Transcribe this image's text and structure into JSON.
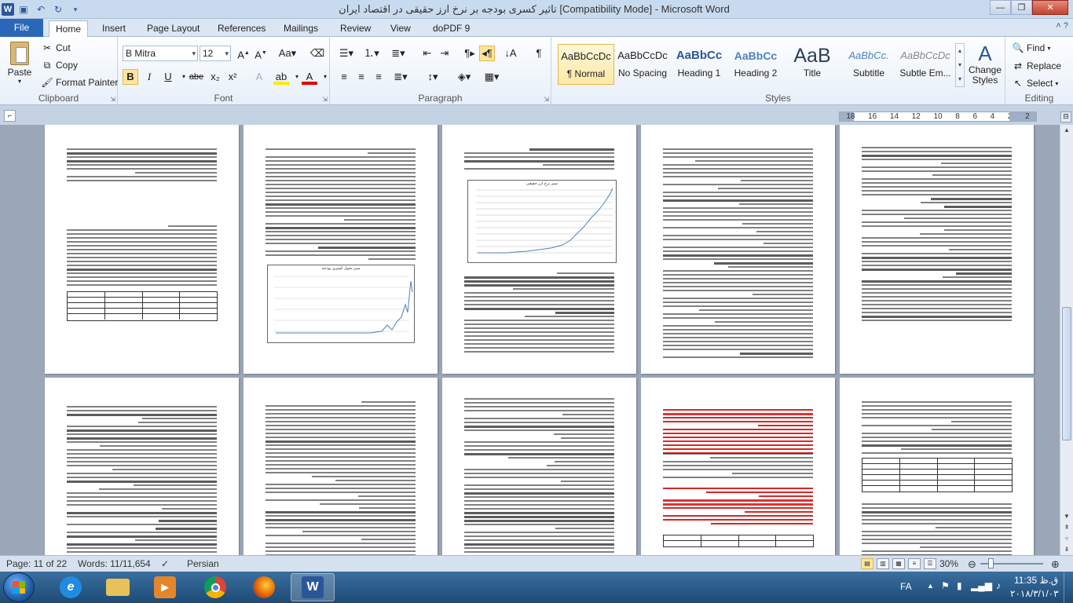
{
  "titlebar": {
    "title": "تاثیر کسری بودجه بر نرخ ارز حقیقی در اقتصاد ایران [Compatibility Mode]  -  Microsoft Word",
    "minimize": "—",
    "maximize": "❐",
    "close": "✕"
  },
  "tabs": {
    "file": "File",
    "items": [
      "Home",
      "Insert",
      "Page Layout",
      "References",
      "Mailings",
      "Review",
      "View",
      "doPDF 9"
    ],
    "active": "Home"
  },
  "clipboard": {
    "paste": "Paste",
    "cut": "Cut",
    "copy": "Copy",
    "format_painter": "Format Painter",
    "label": "Clipboard"
  },
  "font": {
    "family": "B Mitra",
    "size": "12",
    "label": "Font",
    "bold": "B",
    "italic": "I",
    "underline": "U",
    "strike": "abe",
    "subscript": "x₂",
    "superscript": "x²"
  },
  "paragraph": {
    "label": "Paragraph"
  },
  "styles": {
    "label": "Styles",
    "items": [
      {
        "preview": "AaBbCcDc",
        "name": "¶ Normal"
      },
      {
        "preview": "AaBbCcDc",
        "name": "No Spacing"
      },
      {
        "preview": "AaBbCc",
        "name": "Heading 1"
      },
      {
        "preview": "AaBbCc",
        "name": "Heading 2"
      },
      {
        "preview": "AaB",
        "name": "Title"
      },
      {
        "preview": "AaBbCc.",
        "name": "Subtitle"
      },
      {
        "preview": "AaBbCcDc",
        "name": "Subtle Em..."
      }
    ],
    "change_styles": "Change Styles"
  },
  "editing": {
    "label": "Editing",
    "find": "Find",
    "replace": "Replace",
    "select": "Select"
  },
  "ruler": {
    "ticks": [
      "18",
      "16",
      "14",
      "12",
      "10",
      "8",
      "6",
      "4",
      "2",
      "2"
    ]
  },
  "document": {
    "chart_top_title": "سیر نرخ ارز حقیقی",
    "chart_bottom_title": "سیر تحول کسری بودجه"
  },
  "statusbar": {
    "page": "Page: 11 of 22",
    "words": "Words: 11/11,654",
    "language": "Persian",
    "zoom": "30%"
  },
  "taskbar": {
    "lang": "FA",
    "time": "11:35 ق.ظ",
    "date": "۲۰۱۸/۳/۱/۰۳"
  },
  "colors": {
    "accent": "#2b579a",
    "file_tab": "#2b67b8",
    "highlight": "#fde59d",
    "red_text": "#d40000"
  }
}
